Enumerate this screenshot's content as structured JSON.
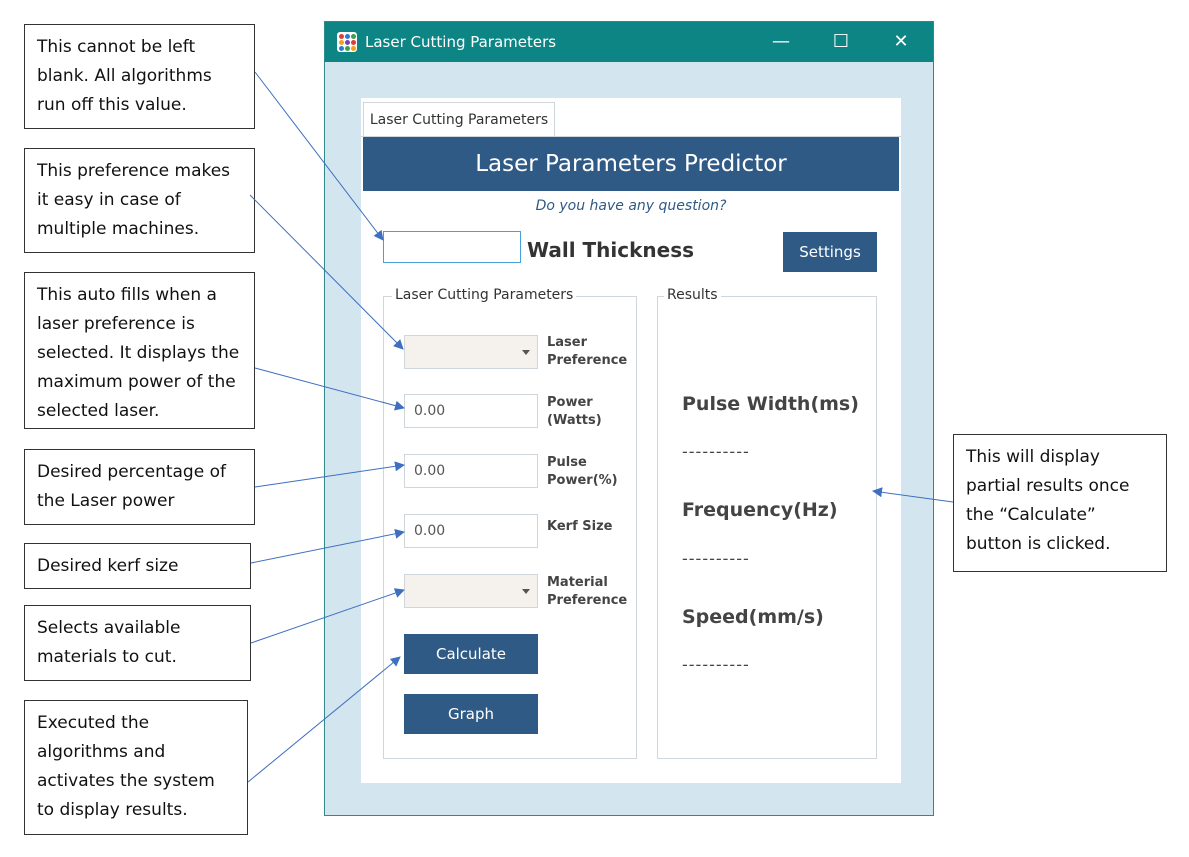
{
  "window": {
    "title": "Laser Cutting Parameters",
    "controls": {
      "minimize": "—",
      "maximize": "☐",
      "close": "✕"
    }
  },
  "tab": {
    "label": "Laser Cutting Parameters"
  },
  "header": {
    "title": "Laser Parameters Predictor"
  },
  "question_link": "Do you have any question?",
  "wall_thickness": {
    "label": "Wall Thickness",
    "value": ""
  },
  "settings_button": "Settings",
  "params_group": {
    "title": "Laser Cutting Parameters",
    "laser_preference": {
      "label_line1": "Laser",
      "label_line2": "Preference",
      "value": ""
    },
    "power": {
      "label_line1": "Power",
      "label_line2": "(Watts)",
      "value": "0.00"
    },
    "pulse_power": {
      "label_line1": "Pulse",
      "label_line2": "Power(%)",
      "value": "0.00"
    },
    "kerf_size": {
      "label": "Kerf Size",
      "value": "0.00"
    },
    "material_preference": {
      "label_line1": "Material",
      "label_line2": "Preference",
      "value": ""
    },
    "calculate_button": "Calculate",
    "graph_button": "Graph"
  },
  "results_group": {
    "title": "Results",
    "pulse_width": {
      "label": "Pulse Width(ms)",
      "value": "----------"
    },
    "frequency": {
      "label": "Frequency(Hz)",
      "value": "----------"
    },
    "speed": {
      "label": "Speed(mm/s)",
      "value": "----------"
    }
  },
  "callouts": {
    "wall_thickness_note": "This cannot be left blank. All algorithms run off this value.",
    "laser_preference_note": "This preference makes it easy in case of multiple machines.",
    "power_note": "This auto fills when a laser preference is selected. It displays the maximum power of the selected laser.",
    "pulse_power_note": "Desired percentage of the Laser power",
    "kerf_note": "Desired kerf size",
    "material_note": "Selects available materials to cut.",
    "calculate_note": "Executed the algorithms and activates the system to display results.",
    "results_note": "This will display partial results once the “Calculate” button is clicked."
  },
  "colors": {
    "titlebar": "#0d8585",
    "window_bg": "#d3e6f0",
    "accent": "#2e5a85",
    "arrow": "#3e6fc0"
  }
}
